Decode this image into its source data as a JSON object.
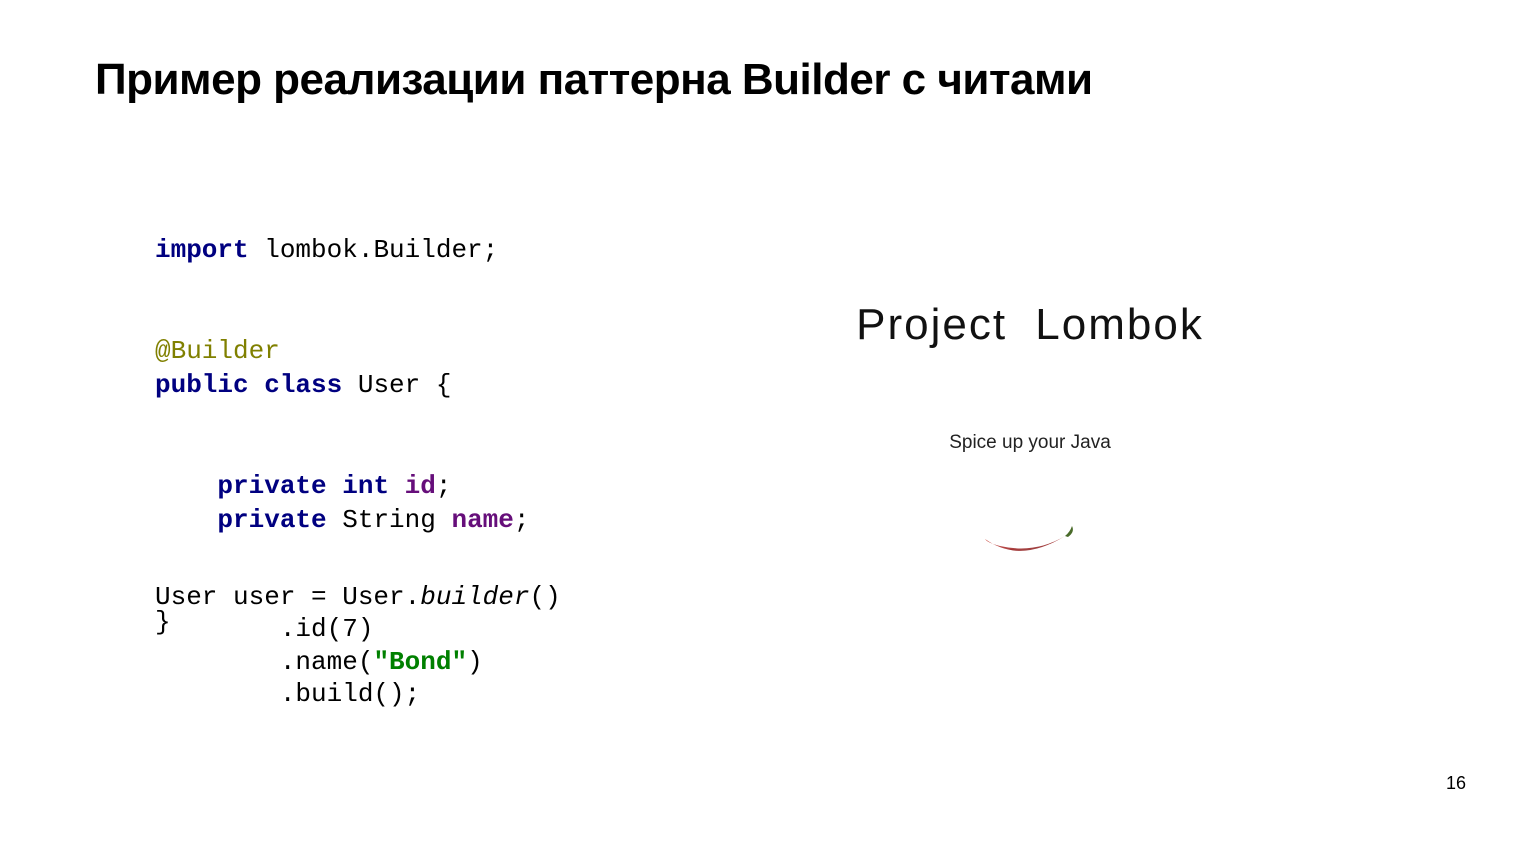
{
  "title": "Пример реализации паттерна Builder с читами",
  "code1": {
    "l1_kw1": "import",
    "l1_rest": " lombok.Builder;",
    "l2_annot": "@Builder",
    "l3_kw1": "public class",
    "l3_rest": " User {",
    "l4_indent": "    ",
    "l4_kw1": "private int",
    "l4_sp": " ",
    "l4_field": "id",
    "l4_end": ";",
    "l5_indent": "    ",
    "l5_kw1": "private",
    "l5_mid": " String ",
    "l5_field": "name",
    "l5_end": ";",
    "l6": "}"
  },
  "code2": {
    "l1_a": "User user = User.",
    "l1_b": "builder",
    "l1_c": "()",
    "l2": "        .id(7)",
    "l3_a": "        .name(",
    "l3_b": "\"Bond\"",
    "l3_c": ")",
    "l4": "        .build();"
  },
  "logo": {
    "title": "Project  Lombok",
    "tagline": "Spice up your Java"
  },
  "pageNumber": "16"
}
